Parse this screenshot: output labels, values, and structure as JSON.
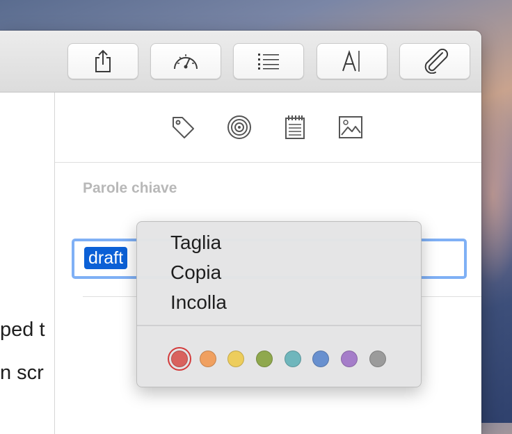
{
  "editor": {
    "lines": [
      "ped t",
      "n scr"
    ]
  },
  "toolbar": {
    "buttons": [
      {
        "name": "share",
        "icon": "share-icon"
      },
      {
        "name": "statistics",
        "icon": "gauge-icon"
      },
      {
        "name": "outline",
        "icon": "list-icon"
      },
      {
        "name": "typography",
        "icon": "text-cursor-icon"
      },
      {
        "name": "attachments",
        "icon": "paperclip-icon"
      }
    ]
  },
  "inspector": {
    "icons": [
      "tag-icon",
      "target-icon",
      "notepad-icon",
      "image-icon"
    ],
    "section_label": "Parole chiave",
    "keyword_token": "draft"
  },
  "context_menu": {
    "items": [
      "Taglia",
      "Copia",
      "Incolla"
    ],
    "colors": [
      {
        "name": "red",
        "hex": "#d9625e",
        "selected": true
      },
      {
        "name": "orange",
        "hex": "#f0a060"
      },
      {
        "name": "yellow",
        "hex": "#edcd5c"
      },
      {
        "name": "green",
        "hex": "#8fa84d"
      },
      {
        "name": "teal",
        "hex": "#6fb6bc"
      },
      {
        "name": "blue",
        "hex": "#6890cf"
      },
      {
        "name": "purple",
        "hex": "#a57dc9"
      },
      {
        "name": "gray",
        "hex": "#9b9b9b"
      }
    ]
  }
}
